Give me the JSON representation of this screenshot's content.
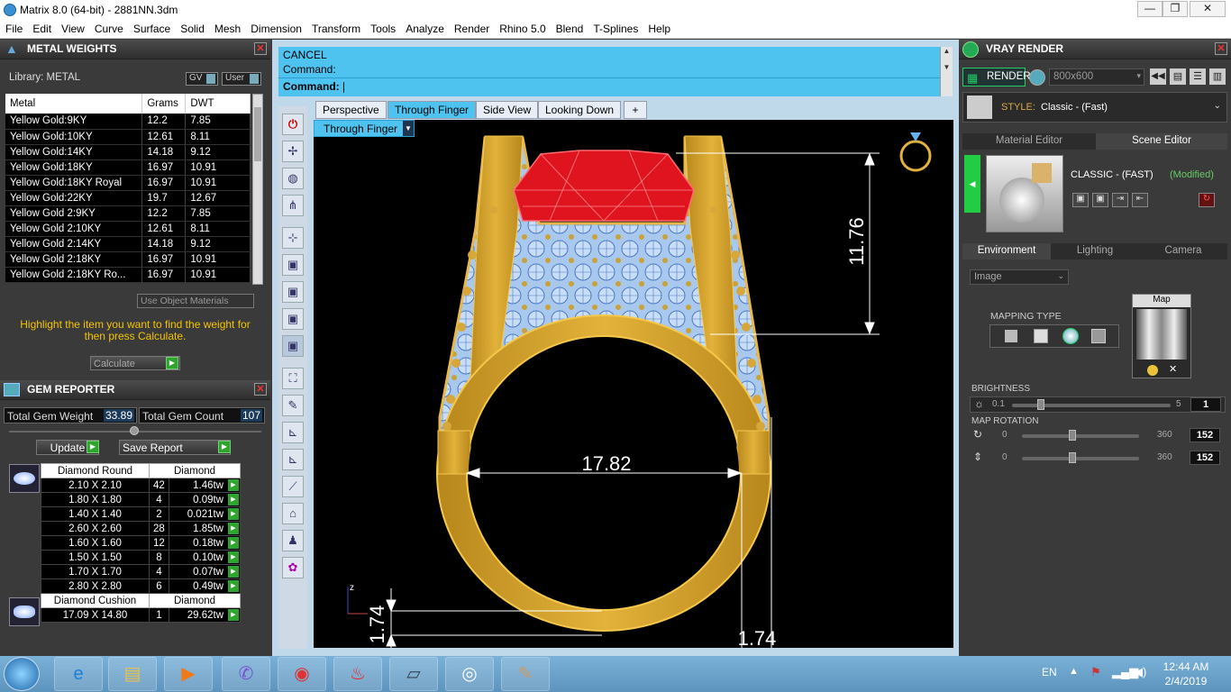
{
  "window": {
    "title": "Matrix 8.0 (64-bit) - 2881NN.3dm",
    "min": "—",
    "max": "❐",
    "close": "✕"
  },
  "menu": [
    "File",
    "Edit",
    "View",
    "Curve",
    "Surface",
    "Solid",
    "Mesh",
    "Dimension",
    "Transform",
    "Tools",
    "Analyze",
    "Render",
    "Rhino 5.0",
    "Blend",
    "T-Splines",
    "Help"
  ],
  "metal": {
    "panel_title": "METAL WEIGHTS",
    "library_label": "Library: METAL",
    "gv_label": "GV",
    "user_label": "User",
    "columns": [
      "Metal",
      "Grams",
      "DWT"
    ],
    "rows": [
      [
        "Yellow Gold:9KY",
        "12.2",
        "7.85"
      ],
      [
        "Yellow Gold:10KY",
        "12.61",
        "8.11"
      ],
      [
        "Yellow Gold:14KY",
        "14.18",
        "9.12"
      ],
      [
        "Yellow Gold:18KY",
        "16.97",
        "10.91"
      ],
      [
        "Yellow Gold:18KY Royal",
        "16.97",
        "10.91"
      ],
      [
        "Yellow Gold:22KY",
        "19.7",
        "12.67"
      ],
      [
        "Yellow Gold 2:9KY",
        "12.2",
        "7.85"
      ],
      [
        "Yellow Gold 2:10KY",
        "12.61",
        "8.11"
      ],
      [
        "Yellow Gold 2:14KY",
        "14.18",
        "9.12"
      ],
      [
        "Yellow Gold 2:18KY",
        "16.97",
        "10.91"
      ],
      [
        "Yellow Gold 2:18KY Ro...",
        "16.97",
        "10.91"
      ]
    ],
    "use_object_materials": "Use Object Materials",
    "hint": "Highlight the item you want to find the weight for then press Calculate.",
    "calculate": "Calculate"
  },
  "gem": {
    "panel_title": "GEM REPORTER",
    "total_weight_label": "Total Gem Weight",
    "total_weight": "33.89",
    "total_count_label": "Total Gem Count",
    "total_count": "107",
    "update": "Update",
    "save_report": "Save Report",
    "group1": {
      "name": "Diamond Round",
      "type": "Diamond",
      "rows": [
        [
          "2.10 X 2.10",
          "42",
          "1.46tw"
        ],
        [
          "1.80 X 1.80",
          "4",
          "0.09tw"
        ],
        [
          "1.40 X 1.40",
          "2",
          "0.021tw"
        ],
        [
          "2.60 X 2.60",
          "28",
          "1.85tw"
        ],
        [
          "1.60 X 1.60",
          "12",
          "0.18tw"
        ],
        [
          "1.50 X 1.50",
          "8",
          "0.10tw"
        ],
        [
          "1.70 X 1.70",
          "4",
          "0.07tw"
        ],
        [
          "2.80 X 2.80",
          "6",
          "0.49tw"
        ]
      ]
    },
    "group2": {
      "name": "Diamond Cushion",
      "type": "Diamond",
      "rows": [
        [
          "17.09 X 14.80",
          "1",
          "29.62tw"
        ]
      ]
    }
  },
  "command": {
    "line1": "CANCEL",
    "line2": "Command:",
    "prompt": "Command:"
  },
  "viewport": {
    "tabs": [
      "Perspective",
      "Through Finger",
      "Side View",
      "Looking Down",
      "+"
    ],
    "active_tab": "Through Finger",
    "view_dropdown": "Through Finger",
    "dims": {
      "height": "11.76",
      "inner": "17.82",
      "left_small": "1.74",
      "bottom_small": "1.74"
    },
    "axis_label": "z"
  },
  "vray": {
    "panel_title": "VRAY RENDER",
    "render_label": "RENDER",
    "resolution": "800x600",
    "style_label": "STYLE:",
    "style_value": "Classic - (Fast)",
    "tab_material": "Material Editor",
    "tab_scene": "Scene Editor",
    "scene_name": "CLASSIC - (FAST)",
    "scene_state": "(Modified)",
    "env_tabs": [
      "Environment",
      "Lighting",
      "Camera"
    ],
    "env_select": "Image",
    "mapping_type": "MAPPING TYPE",
    "map_label": "Map",
    "brightness_label": "BRIGHTNESS",
    "brightness_min": "0.1",
    "brightness_max": "5",
    "brightness_value": "1",
    "rotation_label": "MAP ROTATION",
    "rot_min": "0",
    "rot_max": "360",
    "rot_h": "152",
    "rot_v": "152"
  },
  "taskbar": {
    "lang": "EN",
    "time": "12:44 AM",
    "date": "2/4/2019"
  }
}
